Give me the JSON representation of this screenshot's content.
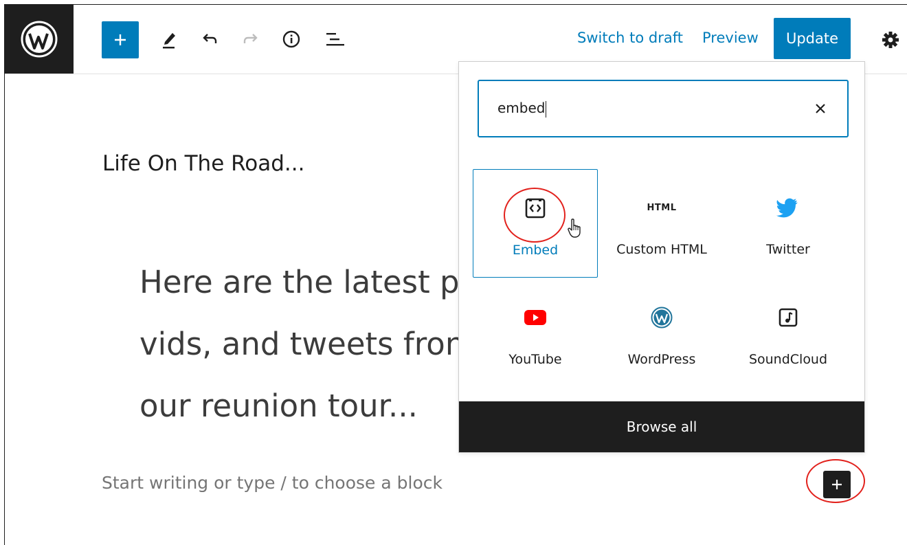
{
  "toolbar": {
    "switch_to_draft": "Switch to draft",
    "preview": "Preview",
    "update": "Update",
    "icons": [
      "wordpress-icon",
      "plus-icon",
      "pencil-icon",
      "undo-icon",
      "redo-icon",
      "info-icon",
      "list-view-icon",
      "gear-icon"
    ]
  },
  "editor": {
    "post_title": "Life On The Road...",
    "quote_lines": [
      "Here are the latest p",
      "vids, and tweets fron",
      "our reunion tour..."
    ],
    "placeholder": "Start writing or type / to choose a block"
  },
  "inserter": {
    "search_value": "embed",
    "results": [
      {
        "label": "Embed",
        "icon": "embed-icon",
        "selected": true
      },
      {
        "label": "Custom HTML",
        "icon": "html-icon",
        "icon_text": "HTML"
      },
      {
        "label": "Twitter",
        "icon": "twitter-icon"
      },
      {
        "label": "YouTube",
        "icon": "youtube-icon"
      },
      {
        "label": "WordPress",
        "icon": "wordpress-icon"
      },
      {
        "label": "SoundCloud",
        "icon": "soundcloud-icon"
      }
    ],
    "browse_all": "Browse all"
  },
  "colors": {
    "accent": "#007cba",
    "dark": "#1e1e1e",
    "highlight_circle": "#e2211c",
    "twitter": "#1da1f2",
    "youtube": "#ff0000",
    "wordpress": "#21759b"
  }
}
